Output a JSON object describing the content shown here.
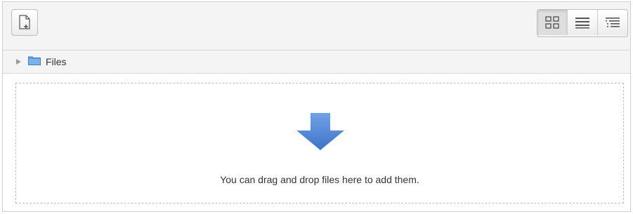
{
  "toolbar": {
    "add_file_icon": "add-file-icon",
    "view_modes": [
      {
        "name": "icons-view",
        "icon": "grid-icon",
        "active": true
      },
      {
        "name": "list-view",
        "icon": "list-icon",
        "active": false
      },
      {
        "name": "tree-view",
        "icon": "tree-icon",
        "active": false
      }
    ]
  },
  "path": {
    "label": "Files"
  },
  "drop_zone": {
    "message": "You can drag and drop files here to add them.",
    "icon": "down-arrow-icon",
    "arrow_color": "#4a84d6"
  }
}
